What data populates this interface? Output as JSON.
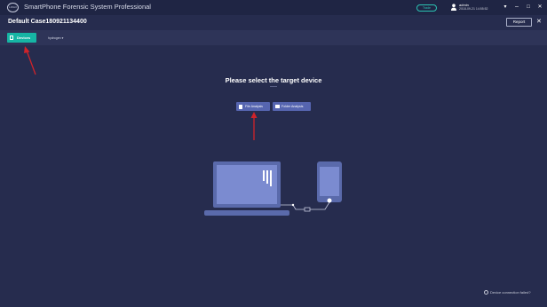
{
  "window": {
    "title": "SmartPhone Forensic System Professional",
    "logo_text": "LOGO",
    "trade_label": "Trade",
    "user": {
      "name": "admin",
      "time": "2018-09-21 14:55:52"
    },
    "controls": {
      "dropdown": "▾",
      "minimize": "–",
      "maximize": "□",
      "close": "✕"
    }
  },
  "case": {
    "title": "Default Case180921134400",
    "caret": "▼",
    "report_label": "Report",
    "close": "✕"
  },
  "tabs": {
    "devices_label": "Devices",
    "device_dropdown": "hydrogen ▾"
  },
  "main": {
    "prompt": "Please select the target device",
    "buttons": [
      {
        "label": "File Analysis"
      },
      {
        "label": "Folder Analysis"
      }
    ]
  },
  "footer": {
    "status": "Device connection failed?"
  },
  "colors": {
    "background": "#262c4e",
    "titlebar": "#1f2544",
    "accent": "#16b5a4",
    "button": "#5665b0",
    "illustration": "#5a6aab",
    "annotation_arrow": "#d0232a"
  }
}
